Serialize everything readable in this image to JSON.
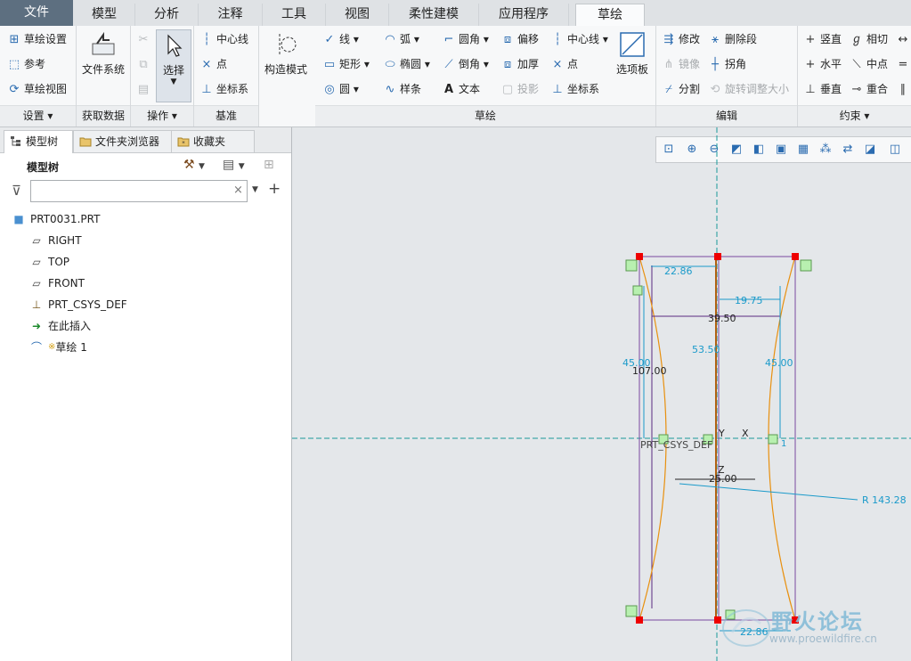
{
  "tabs": [
    {
      "label": "文件"
    },
    {
      "label": "模型"
    },
    {
      "label": "分析"
    },
    {
      "label": "注释"
    },
    {
      "label": "工具"
    },
    {
      "label": "视图"
    },
    {
      "label": "柔性建模"
    },
    {
      "label": "应用程序"
    },
    {
      "label": "草绘"
    }
  ],
  "ribbon": {
    "setup": {
      "sketch_setup": "草绘设置",
      "reference": "参考",
      "sketch_view": "草绘视图",
      "label": "设置 ▾"
    },
    "get_data": {
      "file_system": "文件系统",
      "label": "获取数据"
    },
    "operations": {
      "select": "选择",
      "label": "操作 ▾"
    },
    "datum": {
      "centerline": "中心线",
      "point": "点",
      "csys": "坐标系",
      "label": "基准"
    },
    "construct": {
      "mode": "构造模式"
    },
    "sketch": {
      "line": "线",
      "arc": "弧",
      "fillet": "圆角",
      "offset": "偏移",
      "centerline": "中心线",
      "rectangle": "矩形",
      "ellipse": "椭圆",
      "chamfer": "倒角",
      "thicken": "加厚",
      "point": "点",
      "circle": "圆",
      "spline": "样条",
      "text": "文本",
      "project": "投影",
      "csys": "坐标系",
      "palette": "选项板",
      "label": "草绘"
    },
    "edit": {
      "modify": "修改",
      "delete_segment": "删除段",
      "mirror": "镜像",
      "corner": "拐角",
      "divide": "分割",
      "rotate_resize": "旋转调整大小",
      "label": "编辑"
    },
    "constrain": {
      "vertical": "竖直",
      "tangent": "相切",
      "horizontal": "水平",
      "midpoint": "中点",
      "perpendicular": "垂直",
      "coincident": "重合",
      "label": "约束 ▾"
    }
  },
  "panel": {
    "tabs": [
      {
        "label": "模型树"
      },
      {
        "label": "文件夹浏览器"
      },
      {
        "label": "收藏夹"
      }
    ],
    "tree_title": "模型树",
    "filter_placeholder": "",
    "items": [
      {
        "label": "PRT0031.PRT"
      },
      {
        "label": "RIGHT"
      },
      {
        "label": "TOP"
      },
      {
        "label": "FRONT"
      },
      {
        "label": "PRT_CSYS_DEF"
      },
      {
        "label": "在此插入"
      },
      {
        "label": "草绘 1"
      }
    ]
  },
  "canvas": {
    "dims": {
      "d_top_left": "22.86",
      "d_right_top": "19.75",
      "d_width": "39.50",
      "d_height_center": "53.50",
      "d_left_45": "45.00",
      "d_right_45": "45.00",
      "d_total": "107.00",
      "d_bottom_mid": "25.00",
      "d_radius": "R 143.28",
      "d_bottom": "22.86"
    },
    "labels": {
      "csys": "PRT_CSYS_DEF",
      "y": "Y",
      "x": "X",
      "z": "Z",
      "one": "1"
    },
    "watermark": {
      "cn": "野火论坛",
      "url": "www.proewildfire.cn"
    }
  }
}
